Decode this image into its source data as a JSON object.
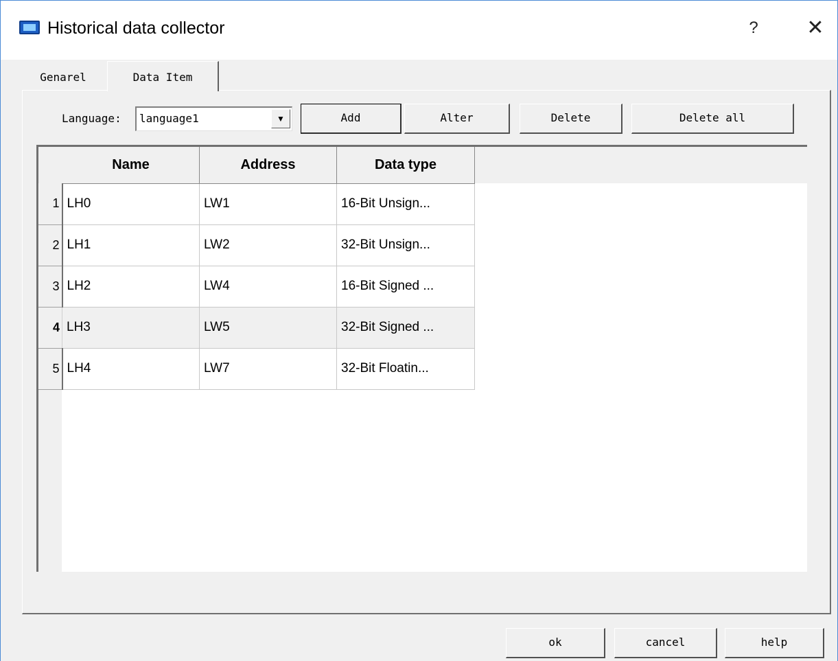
{
  "window": {
    "title": "Historical data collector",
    "help_symbol": "?",
    "close_symbol": "✕"
  },
  "tabs": [
    {
      "label": "Genarel"
    },
    {
      "label": "Data Item"
    }
  ],
  "language": {
    "label": "Language:",
    "value": "language1",
    "options": [
      "language1"
    ]
  },
  "toolbar": {
    "add": "Add",
    "alter": "Alter",
    "delete": "Delete",
    "delete_all": "Delete all"
  },
  "table": {
    "columns": [
      "Name",
      "Address",
      "Data type"
    ],
    "rows": [
      {
        "num": "1",
        "name": "LH0",
        "address": "LW1",
        "type": "16-Bit Unsign..."
      },
      {
        "num": "2",
        "name": "LH1",
        "address": "LW2",
        "type": "32-Bit Unsign..."
      },
      {
        "num": "3",
        "name": "LH2",
        "address": "LW4",
        "type": "16-Bit Signed ..."
      },
      {
        "num": "4",
        "name": "LH3",
        "address": "LW5",
        "type": "32-Bit Signed ..."
      },
      {
        "num": "5",
        "name": "LH4",
        "address": "LW7",
        "type": "32-Bit Floatin..."
      }
    ],
    "selected_row": "4"
  },
  "footer": {
    "ok": "ok",
    "cancel": "cancel",
    "help": "help"
  }
}
